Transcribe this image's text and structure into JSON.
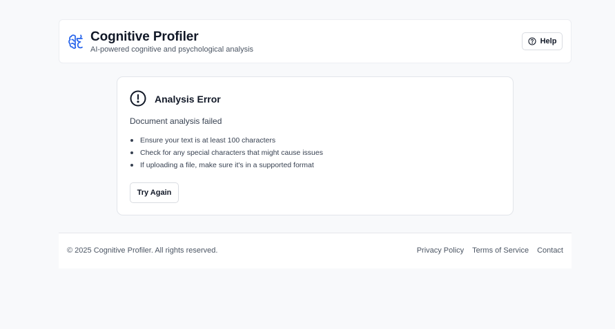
{
  "header": {
    "title": "Cognitive Profiler",
    "subtitle": "AI-powered cognitive and psychological analysis",
    "logo_icon": "brain-icon",
    "help_label": "Help",
    "help_icon": "help-circle-icon"
  },
  "error": {
    "icon": "alert-circle-icon",
    "title": "Analysis Error",
    "message": "Document analysis failed",
    "tips": [
      "Ensure your text is at least 100 characters",
      "Check for any special characters that might cause issues",
      "If uploading a file, make sure it's in a supported format"
    ],
    "retry_label": "Try Again"
  },
  "footer": {
    "copyright": "© 2025 Cognitive Profiler. All rights reserved.",
    "links": [
      "Privacy Policy",
      "Terms of Service",
      "Contact"
    ]
  },
  "colors": {
    "accent": "#2563eb",
    "background": "#f8f9fb",
    "text": "#111827"
  }
}
